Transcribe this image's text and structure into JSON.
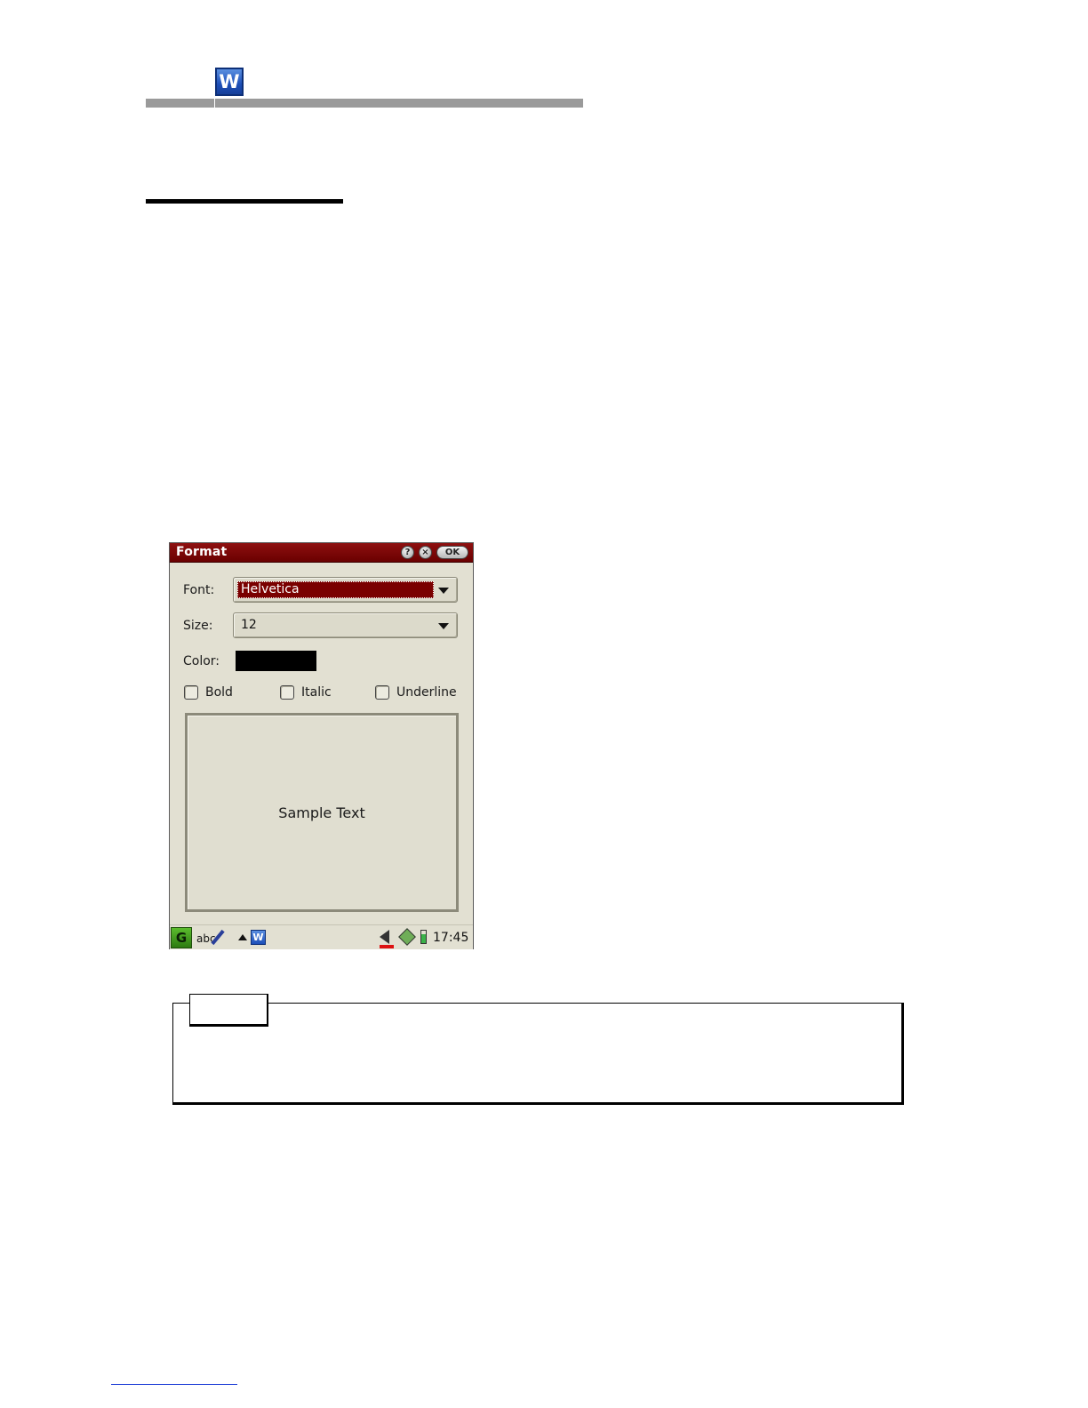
{
  "header": {
    "app_icon": "word-processor-icon",
    "app_icon_letter": "W"
  },
  "dialog": {
    "title": "Format",
    "help_label": "?",
    "close_label": "×",
    "ok_label": "OK",
    "font_label": "Font:",
    "font_value": "Helvetica",
    "size_label": "Size:",
    "size_value": "12",
    "color_label": "Color:",
    "color_value": "#000000",
    "bold_label": "Bold",
    "italic_label": "Italic",
    "underline_label": "Underline",
    "bold_checked": false,
    "italic_checked": false,
    "underline_checked": false,
    "sample_text": "Sample Text",
    "accent_color": "#7a0000"
  },
  "taskbar": {
    "start_label": "G",
    "input_label": "abc",
    "app_letter": "W",
    "clock": "17:45",
    "icons": [
      "start-icon",
      "pen-input-icon",
      "up-arrow-icon",
      "word-app-icon",
      "speaker-icon",
      "network-icon",
      "battery-icon"
    ]
  }
}
